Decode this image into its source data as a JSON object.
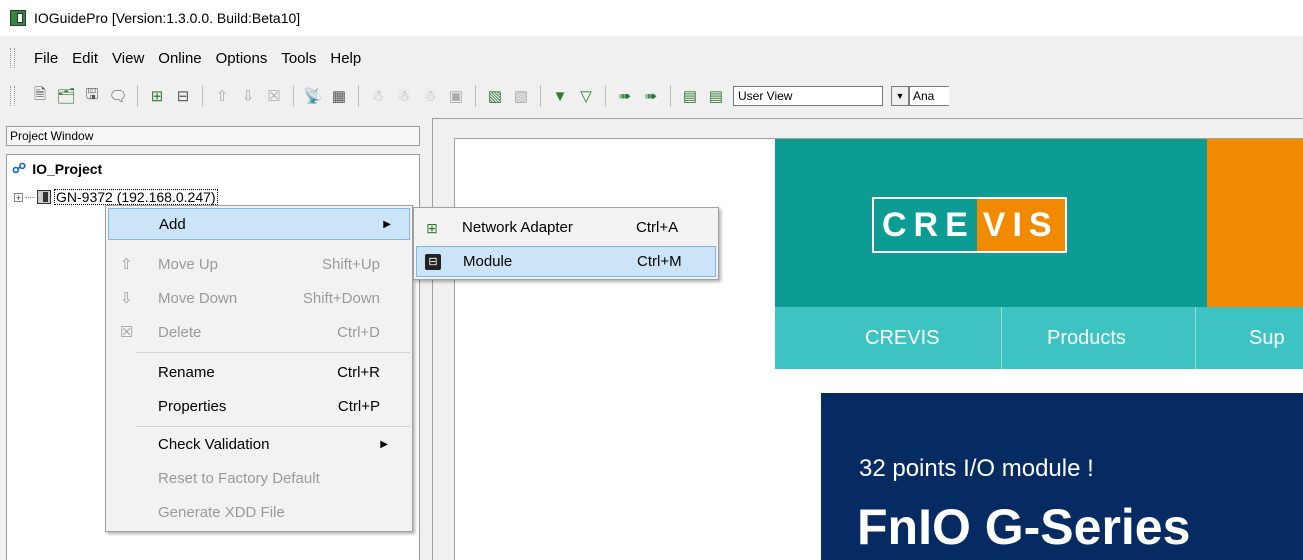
{
  "window": {
    "title": "IOGuidePro  [Version:1.3.0.0. Build:Beta10]"
  },
  "menubar": {
    "items": [
      "File",
      "Edit",
      "View",
      "Online",
      "Options",
      "Tools",
      "Help"
    ]
  },
  "toolbar": {
    "view_select": "User View",
    "view_select2": "Ana"
  },
  "project": {
    "header": "Project Window",
    "root": "IO_Project",
    "node": "GN-9372 (192.168.0.247)"
  },
  "context_menu": {
    "items": [
      {
        "label": "Add",
        "shortcut": "",
        "submenu": true,
        "state": "highlighted"
      },
      {
        "label": "Move Up",
        "shortcut": "Shift+Up",
        "state": "disabled",
        "icon": "arrow-up-icon"
      },
      {
        "label": "Move Down",
        "shortcut": "Shift+Down",
        "state": "disabled",
        "icon": "arrow-down-icon"
      },
      {
        "label": "Delete",
        "shortcut": "Ctrl+D",
        "state": "disabled",
        "icon": "delete-icon"
      },
      {
        "label": "Rename",
        "shortcut": "Ctrl+R",
        "state": "enabled"
      },
      {
        "label": "Properties",
        "shortcut": "Ctrl+P",
        "state": "enabled"
      },
      {
        "label": "Check Validation",
        "shortcut": "",
        "submenu": true,
        "state": "enabled"
      },
      {
        "label": "Reset to Factory Default",
        "shortcut": "",
        "state": "disabled"
      },
      {
        "label": "Generate XDD File",
        "shortcut": "",
        "state": "disabled"
      }
    ]
  },
  "submenu": {
    "items": [
      {
        "label": "Network Adapter",
        "shortcut": "Ctrl+A"
      },
      {
        "label": "Module",
        "shortcut": "Ctrl+M",
        "state": "highlighted"
      }
    ]
  },
  "web": {
    "logo_part1": "CRE",
    "logo_part2": "VIS",
    "nav": [
      "CREVIS",
      "Products",
      "Sup"
    ],
    "hero_subtitle": "32 points I/O module !",
    "hero_title": "FnIO G-Series"
  },
  "colors": {
    "teal": "#0c9c93",
    "orange": "#f28a00",
    "nav_teal": "#3ec3c3",
    "hero_navy": "#062b63",
    "menu_highlight": "#cce4f7"
  }
}
